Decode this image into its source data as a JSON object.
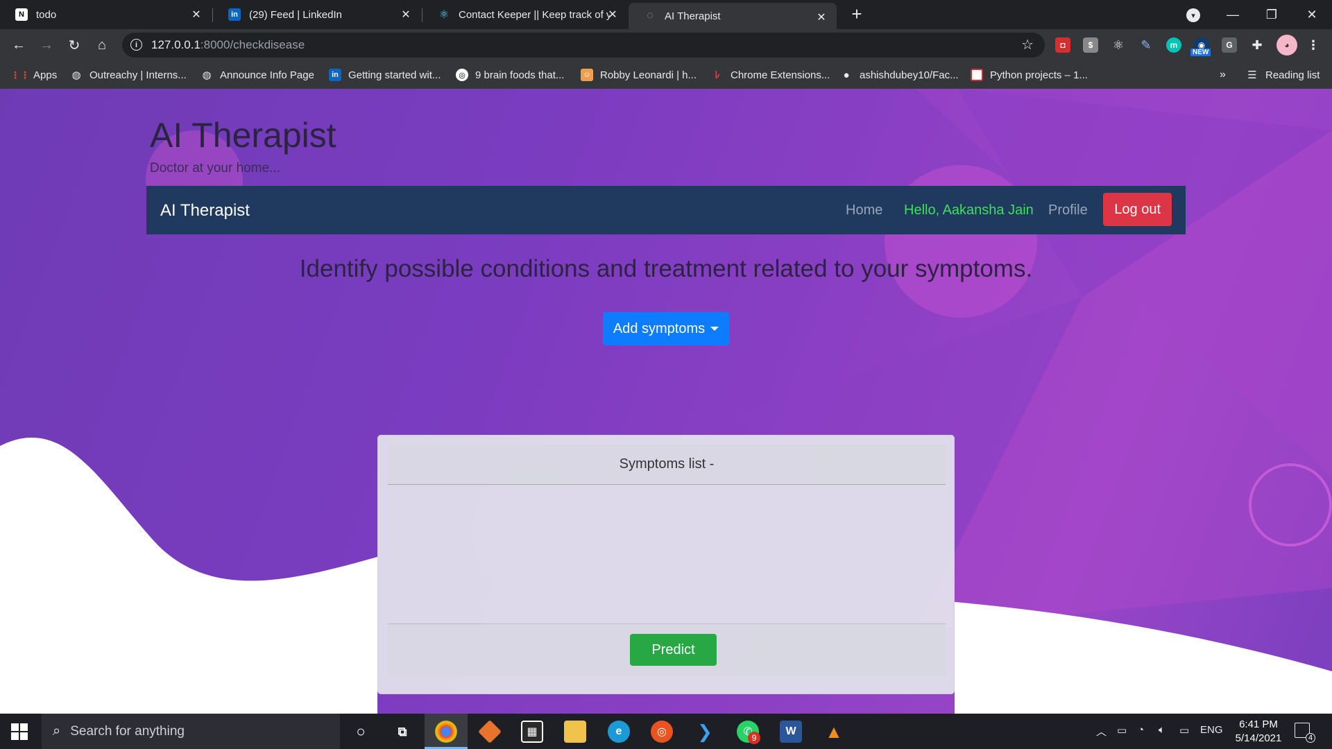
{
  "browser": {
    "tabs": [
      {
        "title": "todo",
        "icon": "notion-icon",
        "icon_text": "N"
      },
      {
        "title": "(29) Feed | LinkedIn",
        "icon": "linkedin-icon",
        "icon_text": "in"
      },
      {
        "title": "Contact Keeper || Keep track of yo",
        "icon": "react-icon",
        "icon_text": "⚛"
      },
      {
        "title": "AI Therapist",
        "icon": "globe-icon",
        "icon_text": "◌"
      }
    ],
    "url_host": "127.0.0.1",
    "url_path": ":8000/checkdisease",
    "new_badge": "NEW",
    "reading_list": "Reading list",
    "bookmarks": [
      {
        "label": "Apps",
        "icon": "apps-grid-icon"
      },
      {
        "label": "Outreachy | Interns...",
        "icon": "globe-icon"
      },
      {
        "label": "Announce Info Page",
        "icon": "globe-icon"
      },
      {
        "label": "Getting started wit...",
        "icon": "linkedin-icon"
      },
      {
        "label": "9 brain foods that...",
        "icon": "brain-icon"
      },
      {
        "label": "Robby Leonardi | h...",
        "icon": "avatar-icon"
      },
      {
        "label": "Chrome Extensions...",
        "icon": "chrome-ext-icon"
      },
      {
        "label": "ashishdubey10/Fac...",
        "icon": "github-icon"
      },
      {
        "label": "Python projects – 1...",
        "icon": "slides-icon"
      }
    ]
  },
  "page": {
    "title": "AI Therapist",
    "subtitle": "Doctor at your home...",
    "navbar": {
      "brand": "AI Therapist",
      "home": "Home",
      "user": "Hello, Aakansha Jain",
      "profile": "Profile",
      "logout": "Log out"
    },
    "headline": "Identify possible conditions and treatment related to your symptoms.",
    "add_symptoms": "Add symptoms",
    "card": {
      "header": "Symptoms list -",
      "predict": "Predict"
    }
  },
  "taskbar": {
    "search_placeholder": "Search for anything",
    "language": "ENG",
    "time": "6:41 PM",
    "date": "5/14/2021",
    "notification_count": "4",
    "whatsapp_badge": "9"
  },
  "colors": {
    "navbar_bg": "#1f3a5e",
    "logout_bg": "#dc3545",
    "add_symptoms_bg": "#0d7cff",
    "predict_bg": "#28a745",
    "user_greeting": "#3ce05a"
  }
}
